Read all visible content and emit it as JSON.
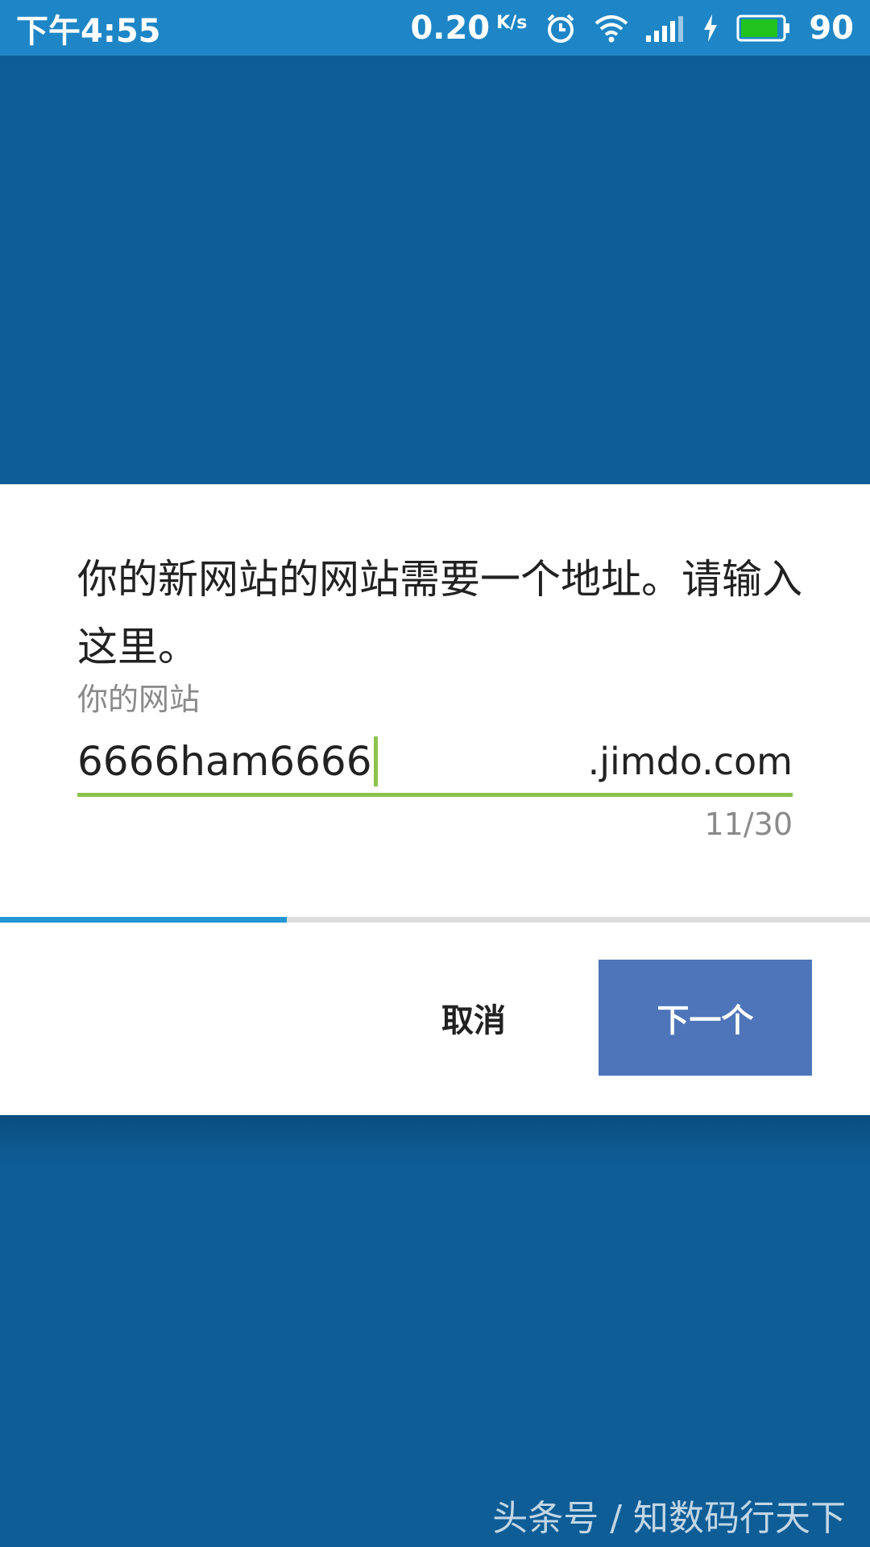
{
  "status_bar": {
    "time": "下午4:55",
    "net_speed": "0.20",
    "net_speed_unit": "K/s",
    "battery": "90",
    "icons": [
      "alarm-icon",
      "wifi-icon",
      "signal-icon",
      "charging-icon",
      "battery-icon"
    ],
    "battery_color": "#22c21f"
  },
  "dialog": {
    "message": "你的新网站的网站需要一个地址。请输入这里。",
    "field_label": "你的网站",
    "input_value": "6666ham6666",
    "domain_suffix": ".jimdo.com",
    "char_counter": "11/30",
    "progress_fraction": 0.33,
    "cancel_label": "取消",
    "next_label": "下一个"
  },
  "colors": {
    "background_blue": "#0e5d96",
    "status_bar_blue": "#1e86c6",
    "accent_green": "#8bc34a",
    "progress_blue": "#2196d3",
    "button_blue": "#4e75b9"
  },
  "watermark": "头条号 / 知数码行天下"
}
